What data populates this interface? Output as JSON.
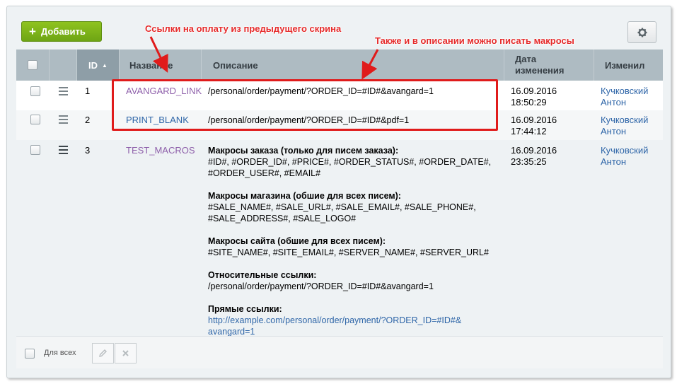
{
  "toolbar": {
    "add_label": "Добавить"
  },
  "table": {
    "headers": {
      "id": "ID",
      "name": "Название",
      "description": "Описание",
      "date": "Дата изменения",
      "changed_by": "Изменил"
    },
    "rows": [
      {
        "id": "1",
        "name": "AVANGARD_LINK",
        "description": "/personal/order/payment/?ORDER_ID=#ID#&avangard=1",
        "date": "16.09.2016",
        "time": "18:50:29",
        "user_first": "Кучковский",
        "user_last": "Антон"
      },
      {
        "id": "2",
        "name": "PRINT_BLANK",
        "description": "/personal/order/payment/?ORDER_ID=#ID#&pdf=1",
        "date": "16.09.2016",
        "time": "17:44:12",
        "user_first": "Кучковский",
        "user_last": "Антон"
      },
      {
        "id": "3",
        "name": "TEST_MACROS",
        "date": "16.09.2016",
        "time": "23:35:25",
        "user_first": "Кучковский",
        "user_last": "Антон",
        "desc": {
          "order_title": "Макросы заказа (только для писем заказа):",
          "order_l1": "#ID#, #ORDER_ID#, #PRICE#, #ORDER_STATUS#, #ORDER_DATE#,",
          "order_l2": "#ORDER_USER#, #EMAIL#",
          "shop_title": "Макросы магазина (обшие для всех писем):",
          "shop_l1": "#SALE_NAME#, #SALE_URL#, #SALE_EMAIL#, #SALE_PHONE#,",
          "shop_l2": "#SALE_ADDRESS#, #SALE_LOGO#",
          "site_title": "Макросы сайта (обшие для всех писем):",
          "site_l1": "#SITE_NAME#, #SITE_EMAIL#, #SERVER_NAME#, #SERVER_URL#",
          "rel_title": "Относительные ссылки:",
          "rel_l1": "/personal/order/payment/?ORDER_ID=#ID#&avangard=1",
          "abs_title": "Прямые ссылки:",
          "abs_l1": "http://example.com/personal/order/payment/?ORDER_ID=#ID#&",
          "abs_l2": "avangard=1"
        }
      }
    ]
  },
  "footer": {
    "for_all_label": "Для всех"
  },
  "annotations": {
    "note1": "Ссылки на оплату из предыдущего скрина",
    "note2": "Также и в описании можно писать макросы",
    "color": "#e52a2a"
  }
}
